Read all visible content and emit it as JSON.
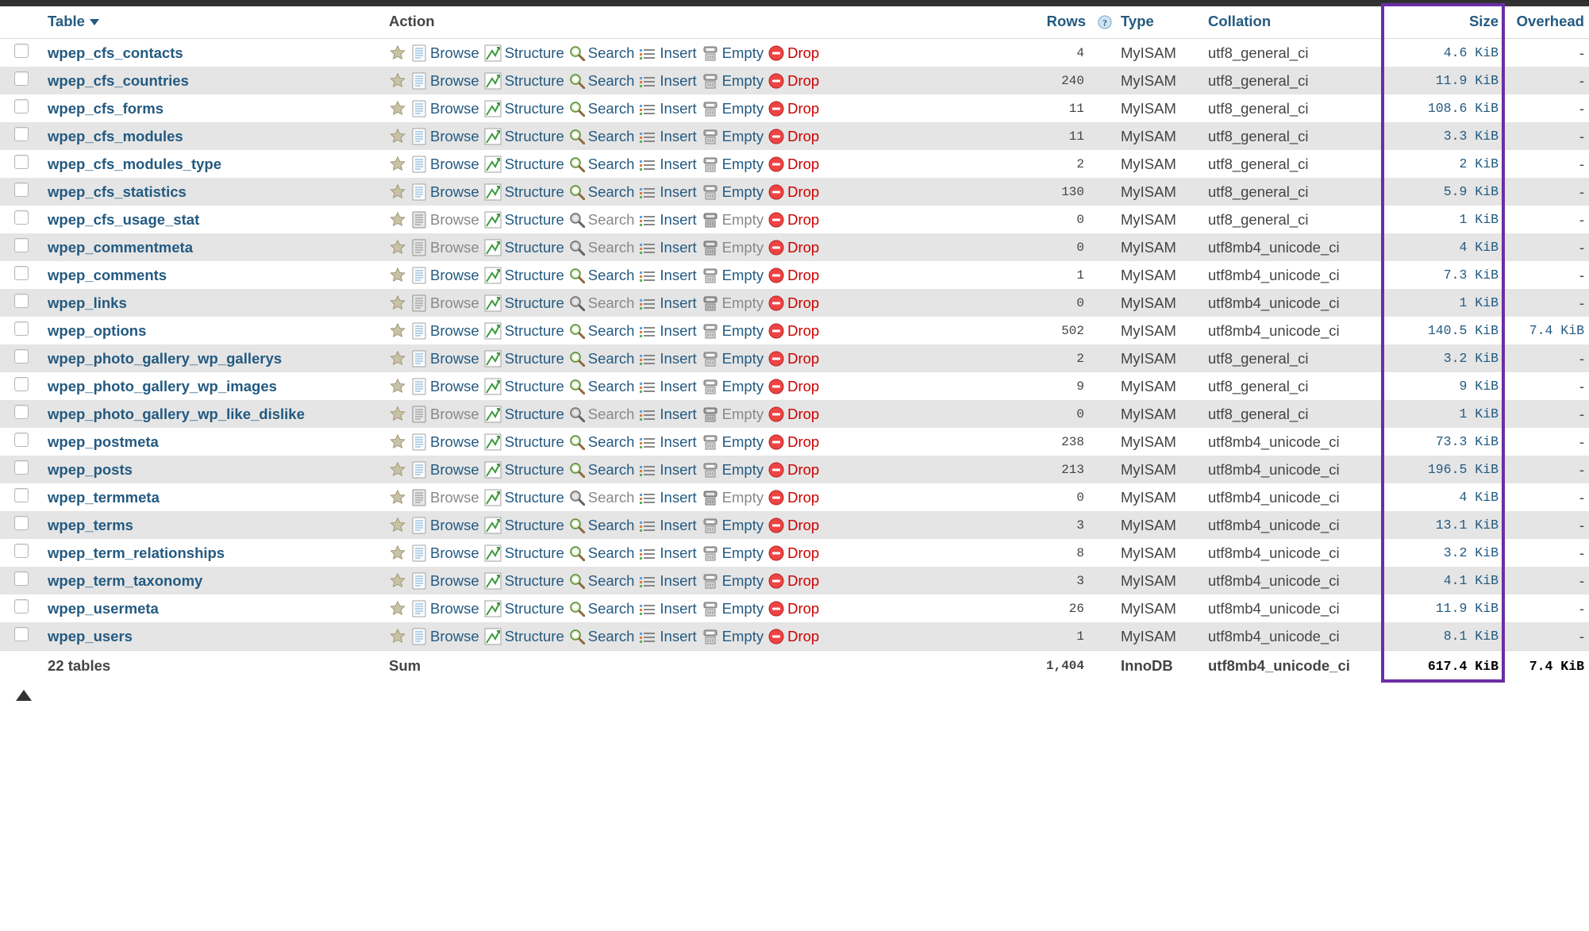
{
  "headers": {
    "table": "Table",
    "action": "Action",
    "rows": "Rows",
    "type": "Type",
    "collation": "Collation",
    "size": "Size",
    "overhead": "Overhead"
  },
  "action_labels": {
    "browse": "Browse",
    "structure": "Structure",
    "search": "Search",
    "insert": "Insert",
    "empty": "Empty",
    "drop": "Drop"
  },
  "tables": [
    {
      "name": "wpep_cfs_contacts",
      "rows": "4",
      "type": "MyISAM",
      "collation": "utf8_general_ci",
      "size": "4.6 KiB",
      "overhead": "-",
      "active": true
    },
    {
      "name": "wpep_cfs_countries",
      "rows": "240",
      "type": "MyISAM",
      "collation": "utf8_general_ci",
      "size": "11.9 KiB",
      "overhead": "-",
      "active": true
    },
    {
      "name": "wpep_cfs_forms",
      "rows": "11",
      "type": "MyISAM",
      "collation": "utf8_general_ci",
      "size": "108.6 KiB",
      "overhead": "-",
      "active": true
    },
    {
      "name": "wpep_cfs_modules",
      "rows": "11",
      "type": "MyISAM",
      "collation": "utf8_general_ci",
      "size": "3.3 KiB",
      "overhead": "-",
      "active": true
    },
    {
      "name": "wpep_cfs_modules_type",
      "rows": "2",
      "type": "MyISAM",
      "collation": "utf8_general_ci",
      "size": "2 KiB",
      "overhead": "-",
      "active": true
    },
    {
      "name": "wpep_cfs_statistics",
      "rows": "130",
      "type": "MyISAM",
      "collation": "utf8_general_ci",
      "size": "5.9 KiB",
      "overhead": "-",
      "active": true
    },
    {
      "name": "wpep_cfs_usage_stat",
      "rows": "0",
      "type": "MyISAM",
      "collation": "utf8_general_ci",
      "size": "1 KiB",
      "overhead": "-",
      "active": false
    },
    {
      "name": "wpep_commentmeta",
      "rows": "0",
      "type": "MyISAM",
      "collation": "utf8mb4_unicode_ci",
      "size": "4 KiB",
      "overhead": "-",
      "active": false
    },
    {
      "name": "wpep_comments",
      "rows": "1",
      "type": "MyISAM",
      "collation": "utf8mb4_unicode_ci",
      "size": "7.3 KiB",
      "overhead": "-",
      "active": true
    },
    {
      "name": "wpep_links",
      "rows": "0",
      "type": "MyISAM",
      "collation": "utf8mb4_unicode_ci",
      "size": "1 KiB",
      "overhead": "-",
      "active": false
    },
    {
      "name": "wpep_options",
      "rows": "502",
      "type": "MyISAM",
      "collation": "utf8mb4_unicode_ci",
      "size": "140.5 KiB",
      "overhead": "7.4 KiB",
      "active": true
    },
    {
      "name": "wpep_photo_gallery_wp_gallerys",
      "rows": "2",
      "type": "MyISAM",
      "collation": "utf8_general_ci",
      "size": "3.2 KiB",
      "overhead": "-",
      "active": true
    },
    {
      "name": "wpep_photo_gallery_wp_images",
      "rows": "9",
      "type": "MyISAM",
      "collation": "utf8_general_ci",
      "size": "9 KiB",
      "overhead": "-",
      "active": true
    },
    {
      "name": "wpep_photo_gallery_wp_like_dislike",
      "rows": "0",
      "type": "MyISAM",
      "collation": "utf8_general_ci",
      "size": "1 KiB",
      "overhead": "-",
      "active": false
    },
    {
      "name": "wpep_postmeta",
      "rows": "238",
      "type": "MyISAM",
      "collation": "utf8mb4_unicode_ci",
      "size": "73.3 KiB",
      "overhead": "-",
      "active": true
    },
    {
      "name": "wpep_posts",
      "rows": "213",
      "type": "MyISAM",
      "collation": "utf8mb4_unicode_ci",
      "size": "196.5 KiB",
      "overhead": "-",
      "active": true
    },
    {
      "name": "wpep_termmeta",
      "rows": "0",
      "type": "MyISAM",
      "collation": "utf8mb4_unicode_ci",
      "size": "4 KiB",
      "overhead": "-",
      "active": false
    },
    {
      "name": "wpep_terms",
      "rows": "3",
      "type": "MyISAM",
      "collation": "utf8mb4_unicode_ci",
      "size": "13.1 KiB",
      "overhead": "-",
      "active": true
    },
    {
      "name": "wpep_term_relationships",
      "rows": "8",
      "type": "MyISAM",
      "collation": "utf8mb4_unicode_ci",
      "size": "3.2 KiB",
      "overhead": "-",
      "active": true
    },
    {
      "name": "wpep_term_taxonomy",
      "rows": "3",
      "type": "MyISAM",
      "collation": "utf8mb4_unicode_ci",
      "size": "4.1 KiB",
      "overhead": "-",
      "active": true
    },
    {
      "name": "wpep_usermeta",
      "rows": "26",
      "type": "MyISAM",
      "collation": "utf8mb4_unicode_ci",
      "size": "11.9 KiB",
      "overhead": "-",
      "active": true
    },
    {
      "name": "wpep_users",
      "rows": "1",
      "type": "MyISAM",
      "collation": "utf8mb4_unicode_ci",
      "size": "8.1 KiB",
      "overhead": "-",
      "active": true
    }
  ],
  "footer": {
    "count_label": "22 tables",
    "sum_label": "Sum",
    "rows": "1,404",
    "type": "InnoDB",
    "collation": "utf8mb4_unicode_ci",
    "size": "617.4 KiB",
    "overhead": "7.4 KiB"
  }
}
